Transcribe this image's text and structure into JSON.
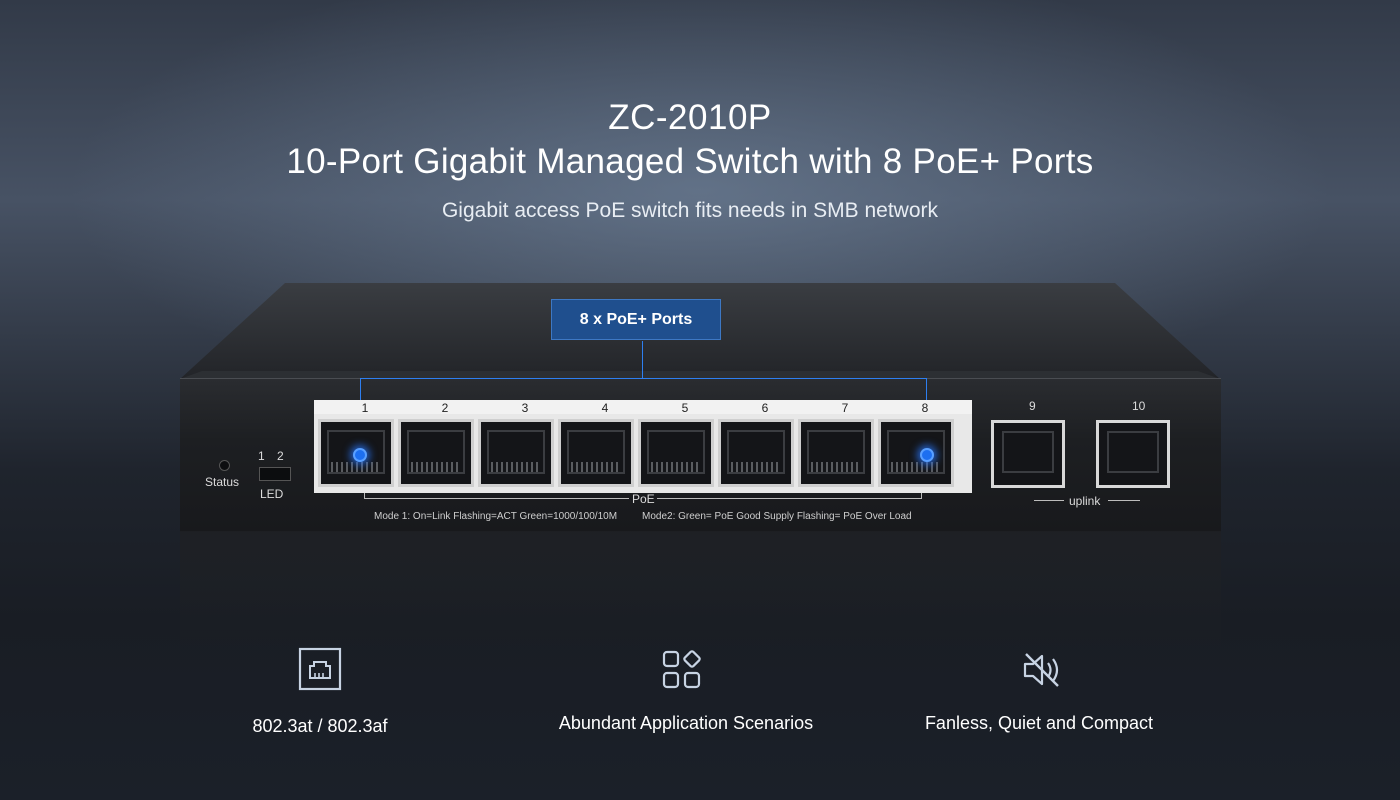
{
  "header": {
    "model": "ZC-2010P",
    "title": "10-Port Gigabit Managed Switch with 8 PoE+ Ports",
    "subtitle": "Gigabit access PoE switch fits needs in SMB network"
  },
  "callout": {
    "label": "8 x PoE+ Ports"
  },
  "switch": {
    "ports": [
      "1",
      "2",
      "3",
      "4",
      "5",
      "6",
      "7",
      "8"
    ],
    "uplink_ports": [
      "9",
      "10"
    ],
    "status_label": "Status",
    "led_numbers": [
      "1",
      "2"
    ],
    "led_label": "LED",
    "poe_label": "PoE",
    "uplink_label": "uplink",
    "mode1_text": "Mode 1:  On=Link  Flashing=ACT   Green=1000/100/10M",
    "mode2_text": "Mode2:  Green= PoE Good Supply   Flashing= PoE Over Load",
    "highlight_color": "#2e7ff0"
  },
  "features": [
    {
      "icon": "ethernet-port-icon",
      "label": "802.3at / 802.3af"
    },
    {
      "icon": "apps-grid-icon",
      "label": "Abundant Application Scenarios"
    },
    {
      "icon": "speaker-muted-icon",
      "label": "Fanless, Quiet and Compact"
    }
  ]
}
